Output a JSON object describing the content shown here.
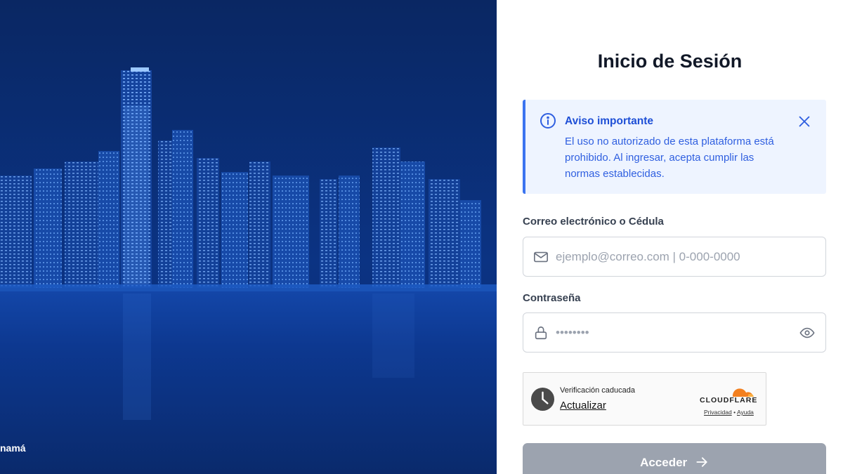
{
  "hero": {
    "caption": "namá"
  },
  "login": {
    "title": "Inicio de Sesión",
    "alert": {
      "title": "Aviso importante",
      "body": "El uso no autorizado de esta plataforma está prohibido. Al ingresar, acepta cumplir las normas establecidas.",
      "icon": "info-icon",
      "close_icon": "close-icon"
    },
    "email": {
      "label": "Correo electrónico o Cédula",
      "placeholder": "ejemplo@correo.com | 0-000-0000",
      "value": "",
      "icon": "mail-icon"
    },
    "password": {
      "label": "Contraseña",
      "placeholder": "••••••••",
      "value": "",
      "icon": "lock-icon",
      "toggle_icon": "eye-icon"
    },
    "captcha": {
      "status": "Verificación caducada",
      "action": "Actualizar",
      "brand": "CLOUDFLARE",
      "privacy": "Privacidad",
      "separator": "•",
      "help": "Ayuda"
    },
    "submit_label": "Acceder",
    "colors": {
      "hero_blue": "#0a3380",
      "alert_bg": "#eef4ff",
      "alert_accent": "#3b74f0",
      "alert_text": "#1e4fd6",
      "submit_disabled": "#9ca3af",
      "cloudflare_orange": "#f38020"
    }
  }
}
